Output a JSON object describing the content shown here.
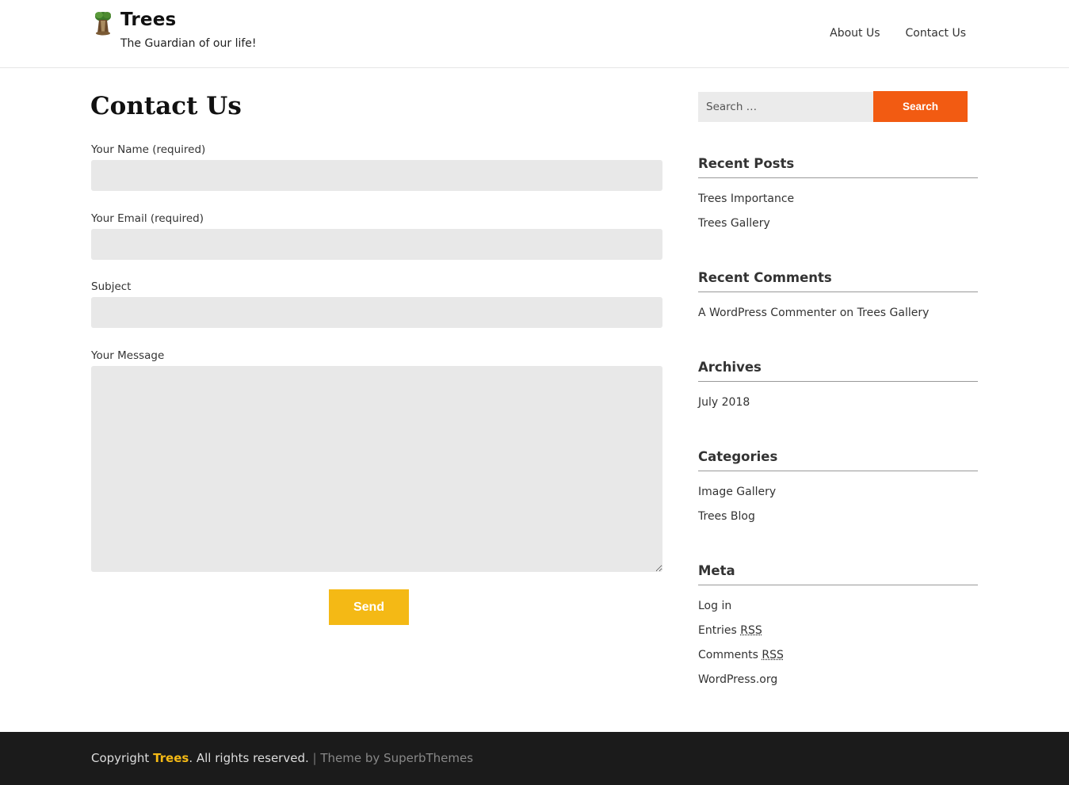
{
  "header": {
    "site_title": "Trees",
    "tagline": "The Guardian of our life!",
    "nav": [
      "About Us",
      "Contact Us"
    ]
  },
  "main": {
    "page_title": "Contact Us",
    "form": {
      "name_label": "Your Name (required)",
      "email_label": "Your Email (required)",
      "subject_label": "Subject",
      "message_label": "Your Message",
      "send_label": "Send"
    }
  },
  "sidebar": {
    "search": {
      "placeholder": "Search …",
      "button_label": "Search"
    },
    "recent_posts": {
      "title": "Recent Posts",
      "items": [
        "Trees Importance",
        "Trees Gallery"
      ]
    },
    "recent_comments": {
      "title": "Recent Comments",
      "author": "A WordPress Commenter",
      "on": "on",
      "post": "Trees Gallery"
    },
    "archives": {
      "title": "Archives",
      "items": [
        "July 2018"
      ]
    },
    "categories": {
      "title": "Categories",
      "items": [
        "Image Gallery",
        "Trees Blog"
      ]
    },
    "meta": {
      "title": "Meta",
      "login": "Log in",
      "entries_prefix": "Entries",
      "comments_prefix": "Comments",
      "rss": "RSS",
      "wordpress": "WordPress.org"
    }
  },
  "footer": {
    "copyright_prefix": "Copyright",
    "brand": "Trees",
    "rights": ". All rights reserved.",
    "separator": "|",
    "theme_by": "Theme by SuperbThemes"
  },
  "colors": {
    "send_button": "#f4b915",
    "search_button": "#f25b12",
    "footer_bg": "#1b1b1b",
    "footer_brand": "#f4b915"
  },
  "icons": {
    "logo": "tree-logo-icon"
  }
}
